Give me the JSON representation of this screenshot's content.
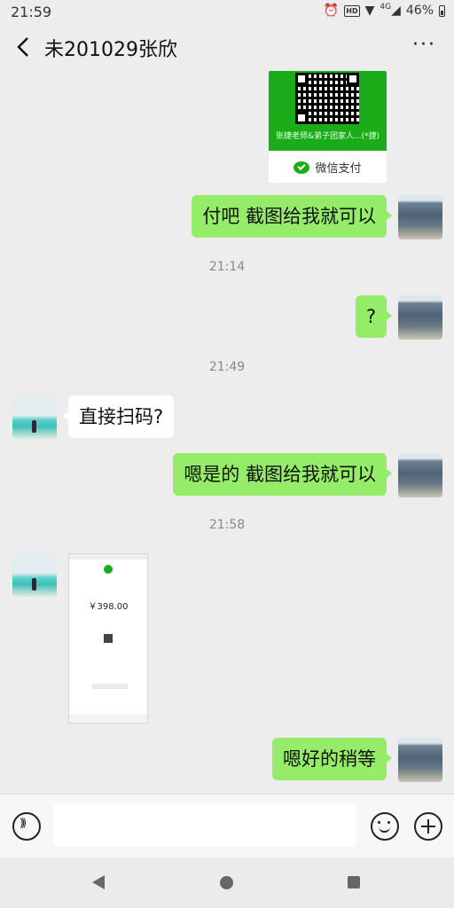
{
  "status_bar": {
    "time": "21:59",
    "network": "4G",
    "battery_percent": "46%",
    "icons": [
      "alarm-icon",
      "hd-icon",
      "wifi-icon",
      "signal-icon",
      "battery-icon"
    ]
  },
  "header": {
    "title": "未201029张欣",
    "more_label": "···"
  },
  "messages": {
    "qr_card": {
      "caption": "张捷老师&弟子团家人...(*捷)",
      "footer": "微信支付"
    },
    "m1": {
      "text": "付吧 截图给我就可以"
    },
    "ts1": "21:14",
    "m2": {
      "text": "?"
    },
    "ts2": "21:49",
    "m3": {
      "text": "直接扫码?"
    },
    "m4": {
      "text": "嗯是的 截图给我就可以"
    },
    "ts3": "21:58",
    "screenshot": {
      "amount": "￥398.00"
    },
    "m5": {
      "text": "嗯好的稍等"
    }
  },
  "input_bar": {
    "text_value": ""
  },
  "colors": {
    "chat_background": "#ededed",
    "my_bubble": "#95ec69",
    "their_bubble": "#ffffff",
    "wechat_green": "#1aad19"
  }
}
